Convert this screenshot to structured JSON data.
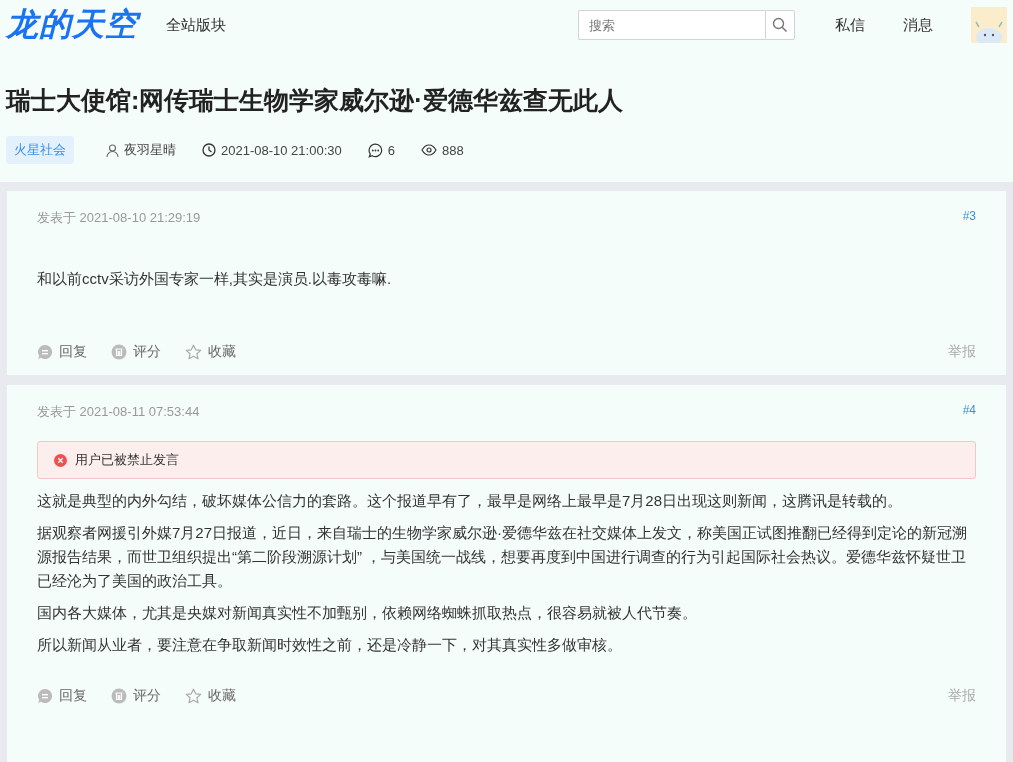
{
  "header": {
    "logo": "龙的天空",
    "nav": "全站版块",
    "search": {
      "placeholder": "搜索"
    },
    "links": [
      "私信",
      "消息"
    ]
  },
  "thread": {
    "title": "瑞士大使馆:网传瑞士生物学家威尔逊·爱德华兹查无此人",
    "forum_tag": "火星社会",
    "author": "夜羽星晴",
    "time": "2021-08-10 21:00:30",
    "comments": "6",
    "views": "888"
  },
  "posts": [
    {
      "posted": "发表于 2021-08-10 21:29:19",
      "floor": "#3",
      "paragraphs": [
        "和以前cctv采访外国专家一样,其实是演员.以毒攻毒嘛."
      ],
      "actions": [
        "回复",
        "评分",
        "收藏"
      ],
      "report": "举报"
    },
    {
      "posted": "发表于 2021-08-11 07:53:44",
      "floor": "#4",
      "banned_notice": "用户已被禁止发言",
      "paragraphs": [
        "这就是典型的内外勾结，破坏媒体公信力的套路。这个报道早有了，最早是网络上最早是7月28日出现这则新闻，这腾讯是转载的。",
        "据观察者网援引外媒7月27日报道，近日，来自瑞士的生物学家威尔逊·爱德华兹在社交媒体上发文，称美国正试图推翻已经得到定论的新冠溯源报告结果，而世卫组织提出“第二阶段溯源计划” ，与美国统一战线，想要再度到中国进行调查的行为引起国际社会热议。爱德华兹怀疑世卫已经沦为了美国的政治工具。",
        "国内各大媒体，尤其是央媒对新闻真实性不加甄别，依赖网络蜘蛛抓取热点，很容易就被人代节奏。",
        "所以新闻从业者，要注意在争取新闻时效性之前，还是冷静一下，对其真实性多做审核。"
      ],
      "actions": [
        "回复",
        "评分",
        "收藏"
      ],
      "report": "举报"
    }
  ]
}
